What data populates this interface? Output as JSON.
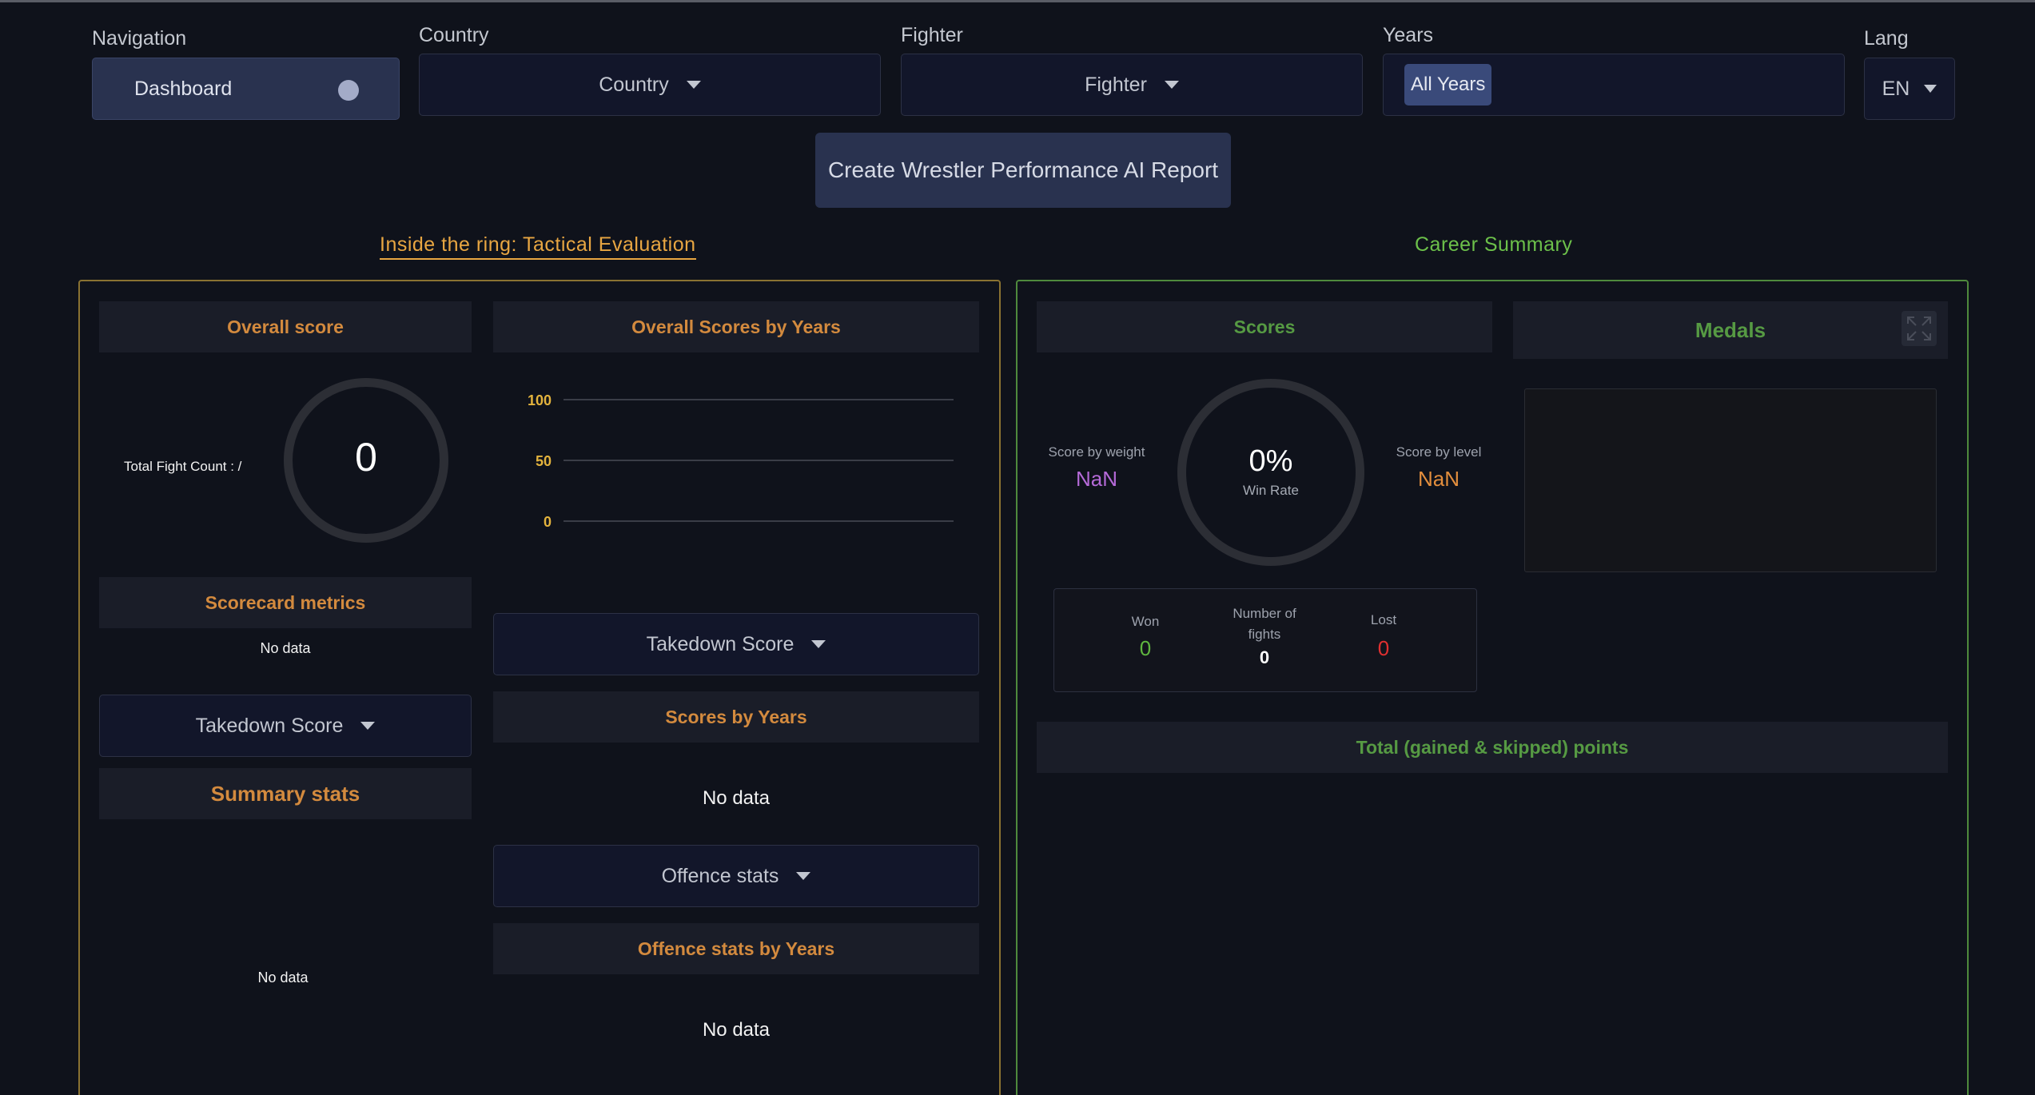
{
  "filters": {
    "navigation": {
      "label": "Navigation",
      "value": "Dashboard"
    },
    "country": {
      "label": "Country",
      "value": "Country"
    },
    "fighter": {
      "label": "Fighter",
      "value": "Fighter"
    },
    "years": {
      "label": "Years",
      "chip": "All Years"
    },
    "lang": {
      "label": "Lang",
      "value": "EN"
    }
  },
  "ai_button": "Create Wrestler Performance AI Report",
  "sections": {
    "tactical": "Inside the ring: Tactical Evaluation",
    "career": "Career Summary"
  },
  "tactical": {
    "overall_score": {
      "title": "Overall score",
      "fight_count_label": "Total Fight Count : /",
      "value": "0"
    },
    "scorecard": {
      "title": "Scorecard metrics",
      "empty": "No data"
    },
    "left_dropdown": "Takedown Score",
    "summary": {
      "title": "Summary stats",
      "empty": "No data"
    },
    "overall_by_years": {
      "title": "Overall Scores by Years",
      "ticks": [
        "100",
        "50",
        "0"
      ]
    },
    "takedown_dropdown": "Takedown Score",
    "scores_by_years": {
      "title": "Scores by Years",
      "empty": "No data"
    },
    "offence_dropdown": "Offence stats",
    "offence_by_years": {
      "title": "Offence stats by Years",
      "empty": "No data"
    }
  },
  "career": {
    "scores": {
      "title": "Scores",
      "by_weight_label": "Score by weight",
      "by_weight_value": "NaN",
      "win_rate_value": "0%",
      "win_rate_label": "Win Rate",
      "by_level_label": "Score by level",
      "by_level_value": "NaN",
      "won_label": "Won",
      "won_value": "0",
      "fights_label_1": "Number of",
      "fights_label_2": "fights",
      "fights_value": "0",
      "lost_label": "Lost",
      "lost_value": "0"
    },
    "medals": {
      "title": "Medals"
    },
    "points": {
      "title": "Total (gained & skipped) points"
    }
  },
  "colors": {
    "tactical_accent": "#e8a642",
    "career_accent": "#6cc04a",
    "by_weight": "#b56ad8",
    "by_level": "#e38e3d",
    "won": "#5fb63f",
    "lost": "#e03030",
    "tick_label": "#e3b33d"
  }
}
